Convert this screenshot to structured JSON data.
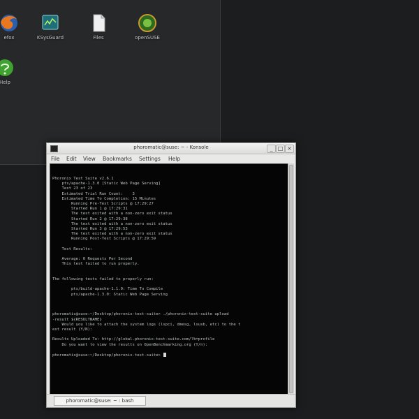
{
  "desktop": {
    "icons": [
      {
        "name": "firefox",
        "label": "efox"
      },
      {
        "name": "system-monitor",
        "label": "KSysGuard"
      },
      {
        "name": "document",
        "label": "Files"
      },
      {
        "name": "suse-chameleon",
        "label": "openSUSE"
      },
      {
        "name": "help",
        "label": "Help"
      }
    ]
  },
  "window": {
    "title": "phoromatic@suse: ~ - Konsole",
    "menu": [
      "File",
      "Edit",
      "View",
      "Bookmarks",
      "Settings",
      "Help"
    ],
    "tab_label": "phoromatic@suse: ~ : bash"
  },
  "terminal": {
    "lines": [
      "Phoronix Test Suite v2.6.1",
      "    pts/apache-1.3.0 [Static Web Page Serving]",
      "    Test 23 of 23",
      "    Estimated Trial Run Count:    3",
      "    Estimated Time To Completion: 15 Minutes",
      "        Running Pre-Test Scripts @ 17:29:27",
      "        Started Run 1 @ 17:29:31",
      "        The test exited with a non-zero exit status",
      "        Started Run 2 @ 17:29:38",
      "        The test exited with a non-zero exit status",
      "        Started Run 3 @ 17:29:53",
      "        The test exited with a non-zero exit status",
      "        Running Post-Test Scripts @ 17:29:59",
      "",
      "    Test Results:",
      "",
      "    Average: 0 Requests Per Second",
      "    This test failed to run properly.",
      "",
      "",
      "The following tests failed to properly run:",
      "",
      "        pts/build-apache-1.1.0: Time To Compile",
      "        pts/apache-1.3.0: Static Web Page Serving",
      "",
      "",
      "",
      "phoromatic@suse:~/Desktop/phoronix-test-suite> ./phoronix-test-suite upload",
      "-result ${RESULTNAME}",
      "    Would you like to attach the system logs (lspci, dmesg, lsusb, etc) to the t",
      "est result (Y/N):",
      "",
      "Results Uploaded To: http://global.phoronix-test-suite.com/?k=profile",
      "    Do you want to view the results on OpenBenchmarking.org (Y/n):",
      "",
      "phoromatic@suse:~/Desktop/phoronix-test-suite> "
    ]
  }
}
